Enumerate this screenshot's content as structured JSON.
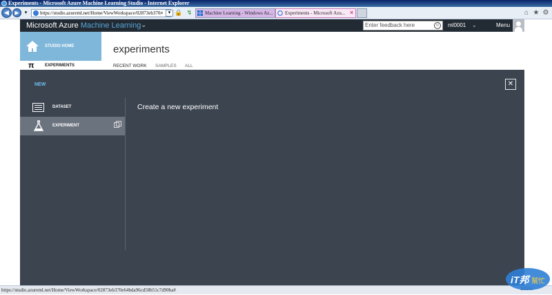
{
  "window": {
    "title": "Experiments - Microsoft Azure Machine Learning Studio - Internet Explorer"
  },
  "browser": {
    "address": "https://studio.azureml.net/Home/ViewWorkspace/02873eb370",
    "tabs": [
      {
        "label": "Machine Learning - Windows Az..."
      },
      {
        "label": "Experiments - Microsoft Azu...",
        "close": "✕"
      }
    ],
    "status_url": "https://studio.azureml.net/Home/ViewWorkspace/02873eb370e64bda96cd58b51c7d90ba#",
    "zoom": "100%"
  },
  "header": {
    "brand": "Microsoft Azure",
    "product": "Machine Learning",
    "feedback_placeholder": "Enter feedback here",
    "user": "ml0001",
    "menu": "Menu"
  },
  "nav": {
    "studio_home": "STUDIO HOME",
    "experiments": "EXPERIMENTS"
  },
  "page": {
    "title": "experiments",
    "tabs": [
      "RECENT WORK",
      "SAMPLES",
      "ALL"
    ]
  },
  "overlay": {
    "new_label": "NEW",
    "close": "✕",
    "items": [
      {
        "label": "DATASET",
        "icon": "dataset-icon"
      },
      {
        "label": "EXPERIMENT",
        "icon": "flask-icon"
      }
    ],
    "content_title": "Create a new experiment"
  },
  "watermark": {
    "text": "iT邦",
    "sub": "幫忙"
  },
  "colors": {
    "azure_header": "#222a33",
    "studio_home": "#7fb7da",
    "overlay": "#3c4450",
    "accent": "#6cc0f0"
  }
}
